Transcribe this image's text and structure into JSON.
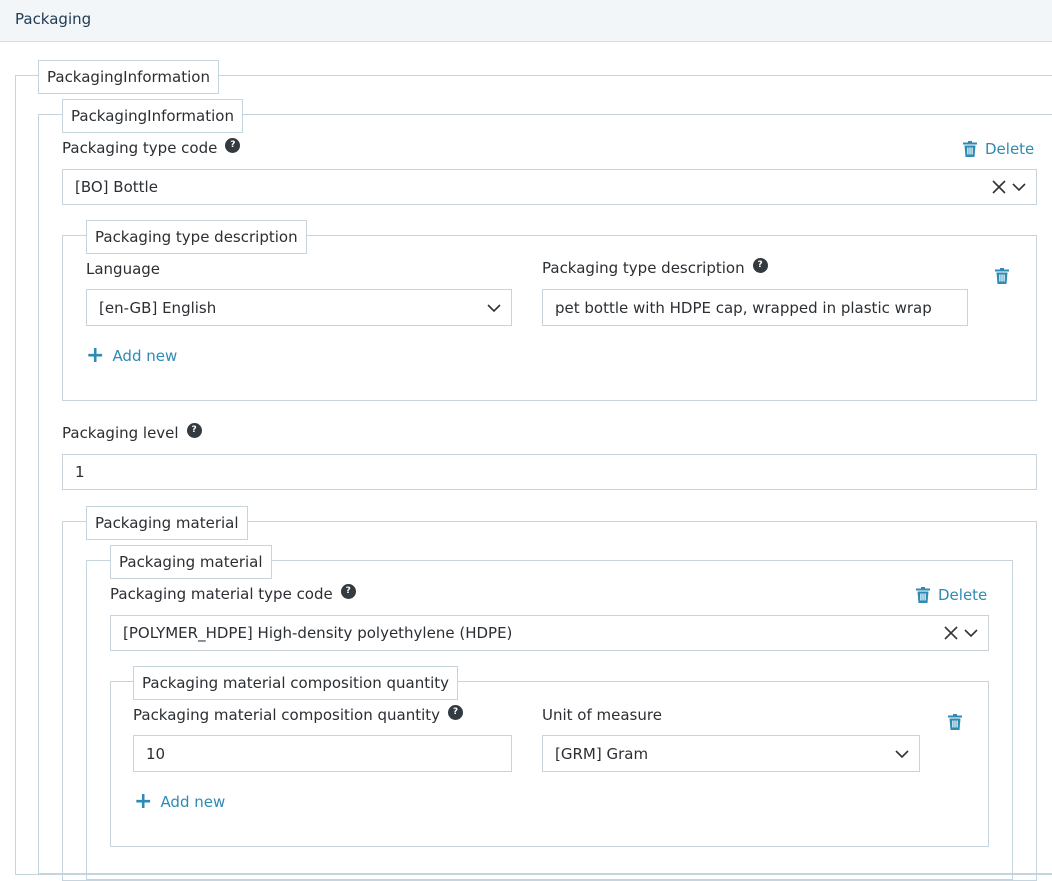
{
  "header": {
    "title": "Packaging"
  },
  "outer_legend": "PackagingInformation",
  "info": {
    "legend": "PackagingInformation",
    "type_code_label": "Packaging type code",
    "type_code_value": "[BO] Bottle",
    "delete_label": "Delete",
    "help_glyph": "?"
  },
  "type_description": {
    "legend": "Packaging type description",
    "language_label": "Language",
    "language_value": "[en-GB] English",
    "description_label": "Packaging type description",
    "description_value": "pet bottle with HDPE cap, wrapped in plastic wrap",
    "add_new_label": "Add new"
  },
  "level": {
    "label": "Packaging level",
    "value": "1"
  },
  "material_outer": {
    "legend": "Packaging material"
  },
  "material": {
    "legend": "Packaging material",
    "type_code_label": "Packaging material type code",
    "type_code_value": "[POLYMER_HDPE] High-density polyethylene (HDPE)",
    "delete_label": "Delete"
  },
  "composition": {
    "legend": "Packaging material composition quantity",
    "quantity_label": "Packaging material composition quantity",
    "quantity_value": "10",
    "unit_label": "Unit of measure",
    "unit_value": "[GRM] Gram",
    "add_new_label": "Add new"
  },
  "colors": {
    "accent": "#2e8bb3",
    "border": "#c6d4de",
    "help": "#333a40"
  }
}
